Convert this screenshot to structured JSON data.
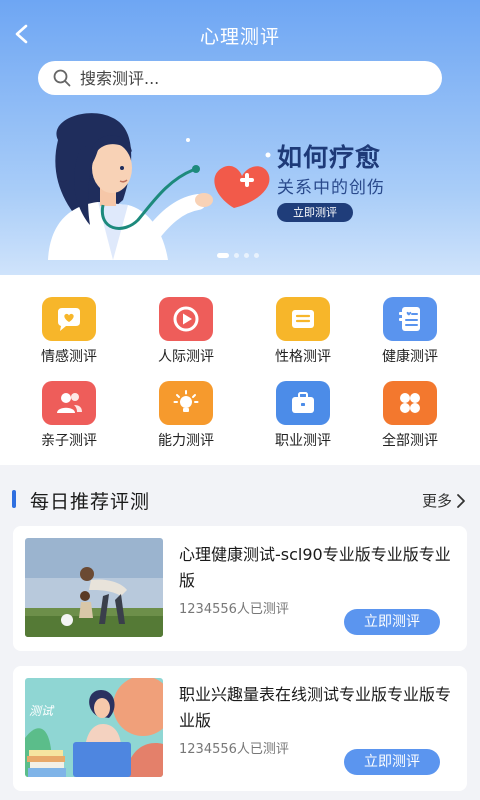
{
  "header": {
    "title": "心理测评"
  },
  "search": {
    "placeholder": "搜索测评..."
  },
  "banner": {
    "title": "如何疗愈",
    "subtitle": "关系中的创伤",
    "button_label": "立即测评",
    "slide_count": 4,
    "active_slide": 0
  },
  "categories": [
    {
      "label": "情感测评",
      "icon": "heart-chat-icon",
      "color": "#f7b62a"
    },
    {
      "label": "人际测评",
      "icon": "play-circle-icon",
      "color": "#ee5d5a"
    },
    {
      "label": "性格测评",
      "icon": "document-icon",
      "color": "#f7b62a"
    },
    {
      "label": "健康测评",
      "icon": "health-record-icon",
      "color": "#5a94ee"
    },
    {
      "label": "亲子测评",
      "icon": "people-icon",
      "color": "#ee5d5a"
    },
    {
      "label": "能力测评",
      "icon": "light-bulb-icon",
      "color": "#f69a2d"
    },
    {
      "label": "职业测评",
      "icon": "briefcase-icon",
      "color": "#4c8ce8"
    },
    {
      "label": "全部测评",
      "icon": "grid-icon",
      "color": "#f3782e"
    }
  ],
  "daily": {
    "title": "每日推荐评测",
    "more_label": "更多",
    "items": [
      {
        "title": "心理健康测试-scl90专业版专业版专业版",
        "count": "1234556人已测评",
        "button_label": "立即测评"
      },
      {
        "title": "职业兴趣量表在线测试专业版专业版专业版",
        "count": "1234556人已测评",
        "button_label": "立即测评",
        "thumb_label": "测试"
      }
    ]
  }
}
